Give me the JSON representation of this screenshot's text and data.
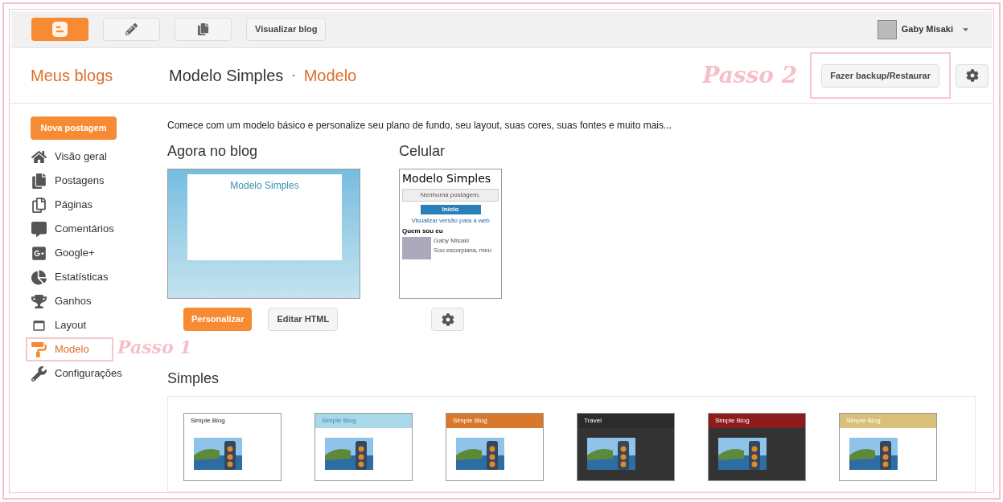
{
  "topbar": {
    "view_blog": "Visualizar blog",
    "user": "Gaby Misaki"
  },
  "header": {
    "my_blogs": "Meus blogs",
    "blog_name": "Modelo Simples",
    "separator": "·",
    "section": "Modelo",
    "backup": "Fazer backup/Restaurar"
  },
  "annotations": [
    {
      "text": "Passo 1"
    },
    {
      "text": "Passo 2"
    }
  ],
  "sidebar": {
    "new_post": "Nova postagem",
    "items": [
      {
        "label": "Visão geral",
        "selected": false
      },
      {
        "label": "Postagens",
        "selected": false
      },
      {
        "label": "Páginas",
        "selected": false
      },
      {
        "label": "Comentários",
        "selected": false
      },
      {
        "label": "Google+",
        "selected": false
      },
      {
        "label": "Estatísticas",
        "selected": false
      },
      {
        "label": "Ganhos",
        "selected": false
      },
      {
        "label": "Layout",
        "selected": false
      },
      {
        "label": "Modelo",
        "selected": true
      },
      {
        "label": "Configurações",
        "selected": false
      }
    ]
  },
  "intro": "Comece com um modelo básico e personalize seu plano de fundo, seu layout, suas cores, suas fontes e muito mais...",
  "current": {
    "title": "Agora no blog",
    "preview_title": "Modelo Simples",
    "customize": "Personalizar",
    "edit_html": "Editar HTML"
  },
  "mobile": {
    "title": "Celular",
    "blog_title": "Modelo Simples",
    "no_posts": "Nenhuma postagem.",
    "home": "Início",
    "web_version": "Visualizar versão para a web",
    "about": "Quem sou eu",
    "author": "Gaby Misaki",
    "bio": "Sou escorpiana, meu"
  },
  "simples": {
    "title": "Simples",
    "templates": [
      {
        "header": "Simple Blog",
        "color": "#ffffff"
      },
      {
        "header": "Simple Blog",
        "color": "#a9d8e8"
      },
      {
        "header": "Simple Blog",
        "color": "#d9772a"
      },
      {
        "header": "Travel",
        "color": "#2b2b2b"
      },
      {
        "header": "Simple Blog",
        "color": "#8e1b1b"
      },
      {
        "header": "Simple Blog",
        "color": "#d8c07a"
      }
    ]
  }
}
